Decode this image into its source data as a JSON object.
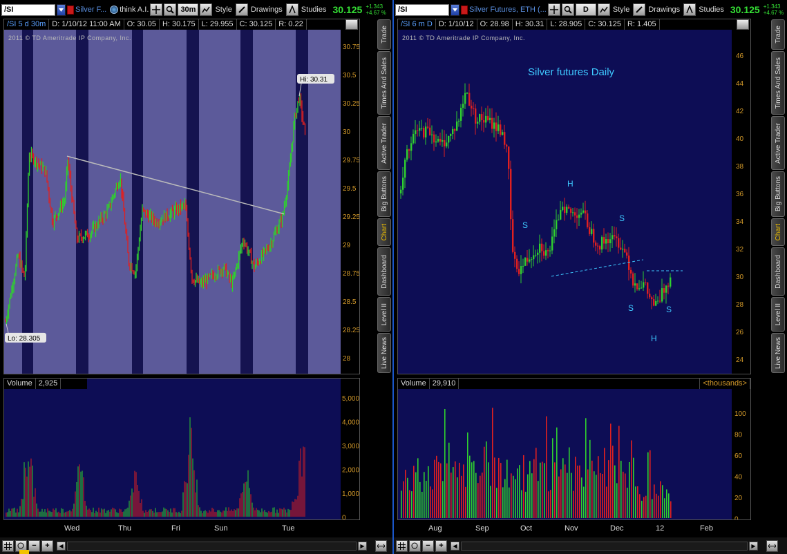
{
  "left": {
    "toolbar": {
      "symbol": "/SI",
      "desc": "Silver F...",
      "think": "think A.I.",
      "timeframe": "30m",
      "style": "Style",
      "drawings": "Drawings",
      "studies": "Studies",
      "price": "30.125",
      "change": "+1.343",
      "change_pct": "+4.67 %"
    },
    "info": {
      "symbol": "/SI 5 d 30m",
      "date": "D: 1/10/12 11:00 AM",
      "open": "O: 30.05",
      "high": "H: 30.175",
      "low": "L: 29.955",
      "close": "C: 30.125",
      "range": "R: 0.22"
    },
    "copyright": "2011 © TD Ameritrade IP Company, Inc.",
    "hi_label": "Hi: 30.31",
    "lo_label": "Lo: 28.305",
    "volume_label": "Volume",
    "volume_value": "2,925",
    "y_ticks": [
      "30.75",
      "30.5",
      "30.25",
      "30",
      "29.75",
      "29.5",
      "29.25",
      "29",
      "28.75",
      "28.5",
      "28.25",
      "28"
    ],
    "vol_ticks": [
      "5,000",
      "4,000",
      "3,000",
      "2,000",
      "1,000",
      "0"
    ],
    "x_ticks": [
      "Wed",
      "Thu",
      "Fri",
      "Sun",
      "Tue"
    ]
  },
  "right": {
    "toolbar": {
      "symbol": "/SI",
      "desc": "Silver Futures, ETH (...",
      "timeframe": "D",
      "style": "Style",
      "drawings": "Drawings",
      "studies": "Studies",
      "price": "30.125",
      "change": "+1.343",
      "change_pct": "+4.67 %"
    },
    "info": {
      "symbol": "/SI 6 m D",
      "date": "D: 1/10/12",
      "open": "O: 28.98",
      "high": "H: 30.31",
      "low": "L: 28.905",
      "close": "C: 30.125",
      "range": "R: 1.405"
    },
    "copyright": "2011 © TD Ameritrade IP Company, Inc.",
    "title": "Silver futures Daily",
    "volume_label": "Volume",
    "volume_value": "29,910",
    "volume_units": "<thousands>",
    "y_ticks": [
      "46",
      "44",
      "42",
      "40",
      "38",
      "36",
      "34",
      "32",
      "30",
      "28",
      "26",
      "24"
    ],
    "vol_ticks": [
      "100",
      "80",
      "60",
      "40",
      "20",
      "0"
    ],
    "x_ticks": [
      "Aug",
      "Sep",
      "Oct",
      "Nov",
      "Dec",
      "12",
      "Feb"
    ],
    "annotations": {
      "s1": "S",
      "h1": "H",
      "s2": "S",
      "s3": "S",
      "s4": "S",
      "h2": "H"
    }
  },
  "side_tabs": [
    "Trade",
    "Times And Sales",
    "Active Trader",
    "Big Buttons",
    "Chart",
    "Dashboard",
    "Level II",
    "Live News"
  ],
  "colors": {
    "up": "#2fd02f",
    "down": "#e02020",
    "accent": "#f2c200",
    "panel_left": "#5c5a9a",
    "panel_right": "#0d0d55"
  }
}
